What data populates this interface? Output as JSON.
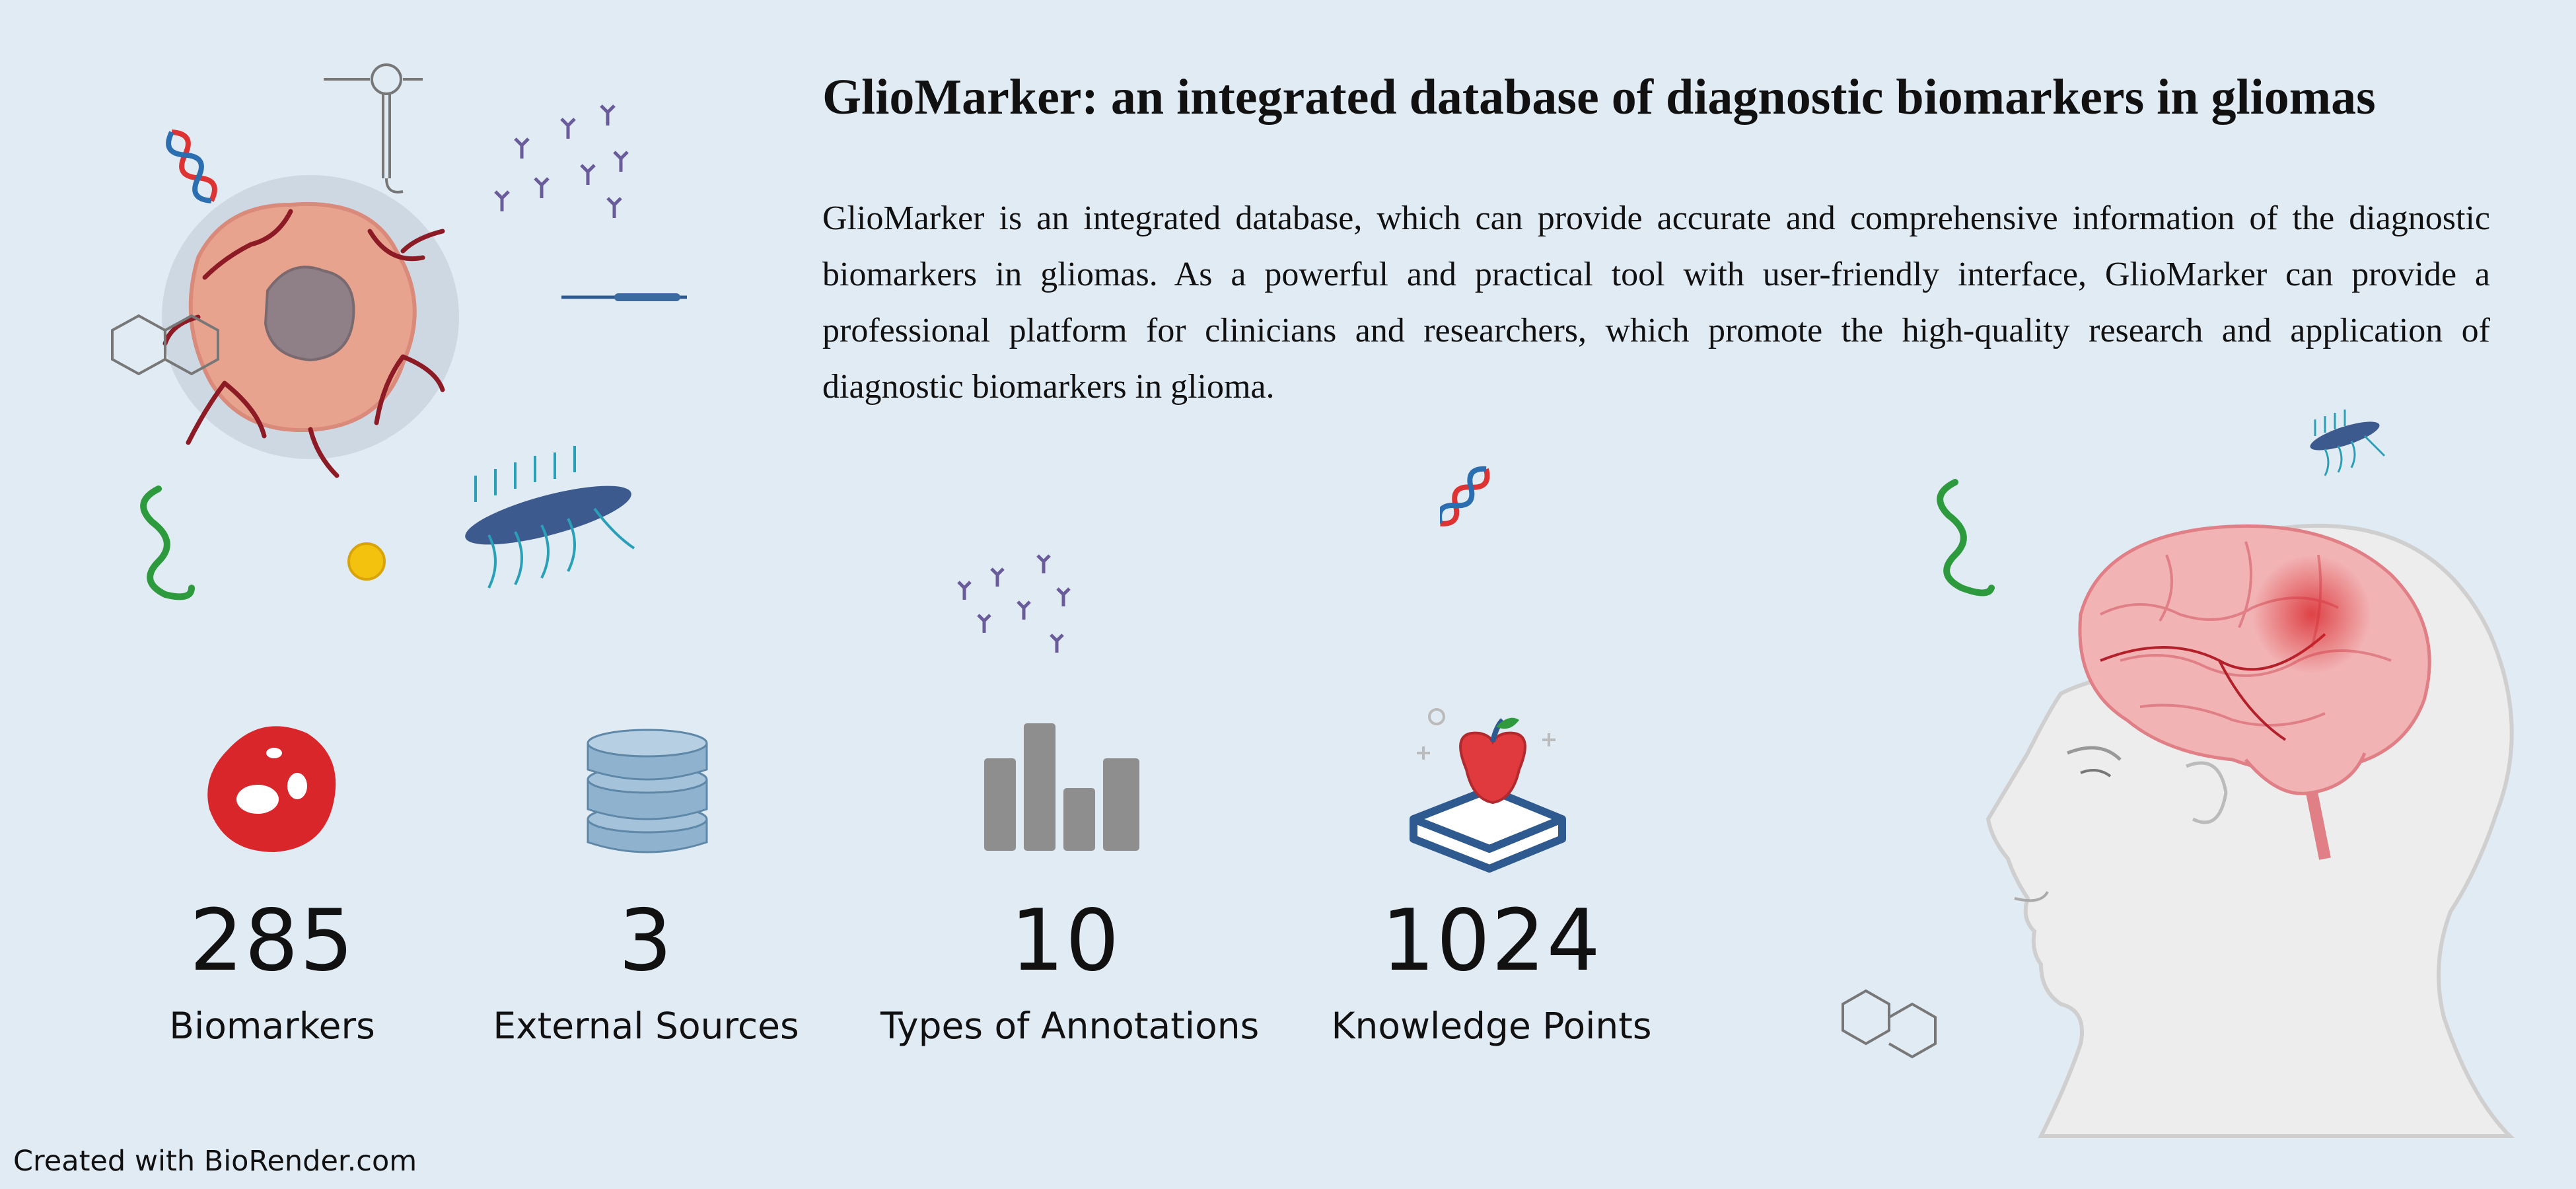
{
  "header": {
    "title": "GlioMarker: an integrated database of diagnostic biomarkers in gliomas",
    "description": "GlioMarker is an integrated database, which can provide accurate and comprehensive information of the diagnostic biomarkers in gliomas. As a powerful and practical tool with user-friendly interface, GlioMarker can provide a professional platform for clinicians and researchers, which promote the high-quality research and application of diagnostic biomarkers in glioma."
  },
  "stats": [
    {
      "value": "285",
      "label": "Biomarkers",
      "icon": "cell-icon"
    },
    {
      "value": "3",
      "label": "External Sources",
      "icon": "database-icon"
    },
    {
      "value": "10",
      "label": "Types of Annotations",
      "icon": "bar-chart-icon"
    },
    {
      "value": "1024",
      "label": "Knowledge Points",
      "icon": "apple-book-icon"
    }
  ],
  "footer": {
    "credit": "Created with BioRender.com"
  },
  "colors": {
    "background": "#e1ebf4",
    "tumor": "#e8a38e",
    "vessel": "#8c1b25",
    "cell_red": "#d9262b",
    "database": "#8fb3cf",
    "bars": "#8e8e8e",
    "book": "#2f5a8f",
    "apple": "#e0393e"
  }
}
